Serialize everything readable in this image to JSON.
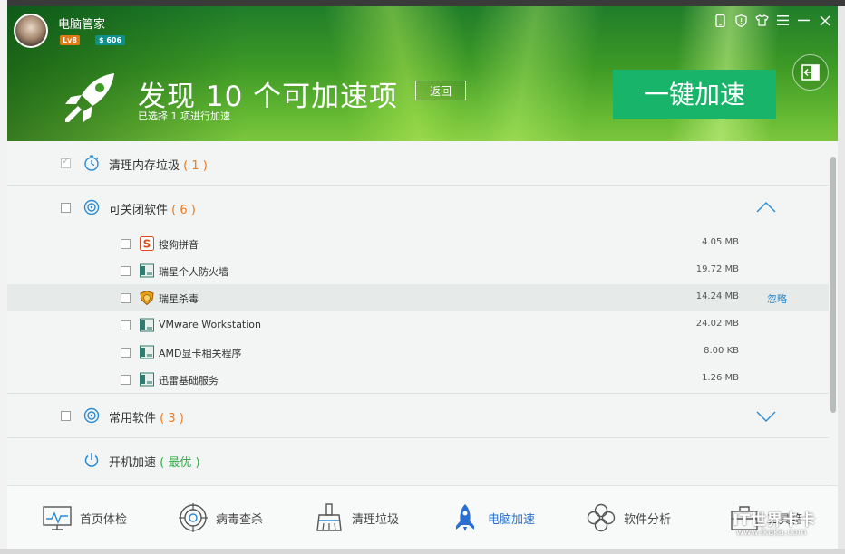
{
  "app": {
    "title": "电脑管家",
    "level": "Lv8",
    "coins": "$ 606"
  },
  "header": {
    "headline": "发现 10 个可加速项",
    "back_label": "返回",
    "subline": "已选择 1 项进行加速",
    "boost_label": "一键加速"
  },
  "groups": [
    {
      "label": "清理内存垃圾",
      "count": "( 1 )",
      "checked": true
    },
    {
      "label": "可关闭软件",
      "count": "( 6 )",
      "checked": false,
      "expanded": true
    },
    {
      "label": "常用软件",
      "count": "( 3 )",
      "checked": false,
      "expanded": false
    },
    {
      "label": "开机加速",
      "count": "( 最优 )"
    }
  ],
  "items": [
    {
      "name": "搜狗拼音",
      "size": "4.05 MB",
      "icon": "sogou-icon"
    },
    {
      "name": "瑞星个人防火墙",
      "size": "19.72 MB",
      "icon": "app-icon"
    },
    {
      "name": "瑞星杀毒",
      "size": "14.24 MB",
      "icon": "lion-icon",
      "action": "忽略"
    },
    {
      "name": "VMware Workstation",
      "size": "24.02 MB",
      "icon": "app-icon"
    },
    {
      "name": "AMD显卡相关程序",
      "size": "8.00 KB",
      "icon": "app-icon"
    },
    {
      "name": "迅雷基础服务",
      "size": "1.26 MB",
      "icon": "app-icon"
    }
  ],
  "nav": [
    {
      "label": "首页体检",
      "icon": "monitor-icon"
    },
    {
      "label": "病毒查杀",
      "icon": "target-icon"
    },
    {
      "label": "清理垃圾",
      "icon": "broom-icon"
    },
    {
      "label": "电脑加速",
      "icon": "rocket-icon",
      "active": true
    },
    {
      "label": "软件分析",
      "icon": "clover-icon"
    },
    {
      "label": "工具箱",
      "icon": "toolbox-icon"
    }
  ],
  "watermark": {
    "line1": "IT世界卡卡",
    "line2": "www.ikaka.com"
  },
  "colors": {
    "accent_green": "#18b46a",
    "count_orange": "#ee7a20",
    "active_blue": "#2a6fcf"
  }
}
